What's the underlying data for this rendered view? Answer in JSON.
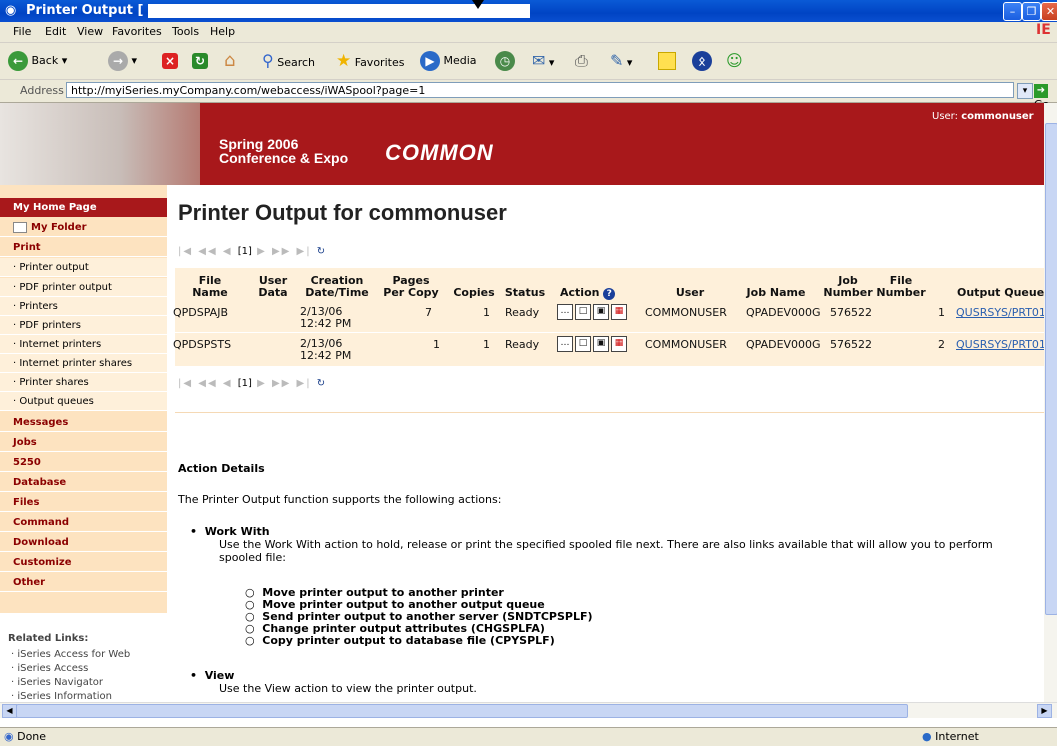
{
  "window": {
    "title": "Printer Output [",
    "ie_logo": "IE"
  },
  "menu": [
    "File",
    "Edit",
    "View",
    "Favorites",
    "Tools",
    "Help"
  ],
  "toolbar": {
    "back": "Back",
    "search": "Search",
    "favorites": "Favorites",
    "media": "Media"
  },
  "address": {
    "label": "Address",
    "url": "http://myiSeries.myCompany.com/webaccess/iWASpool?page=1",
    "go": "Go"
  },
  "banner": {
    "line1": "Spring 2006",
    "line2": "Conference & Expo",
    "logo": "COMMON",
    "user_label": "User:",
    "user": "commonuser"
  },
  "sidebar": {
    "home": "My Home Page",
    "folder": "My Folder",
    "print": "Print",
    "print_items": [
      "Printer output",
      "PDF printer output",
      "Printers",
      "PDF printers",
      "Internet printers",
      "Internet printer shares",
      "Printer shares",
      "Output queues"
    ],
    "sections": [
      "Messages",
      "Jobs",
      "5250",
      "Database",
      "Files",
      "Command",
      "Download",
      "Customize",
      "Other"
    ],
    "related_title": "Related Links:",
    "related": [
      "iSeries Access for Web",
      "iSeries Access",
      "iSeries Navigator",
      "iSeries Information"
    ]
  },
  "main": {
    "heading": "Printer Output for commonuser",
    "pager_page": "[1]",
    "columns": {
      "file_name": [
        "File",
        "Name"
      ],
      "user_data": [
        "User",
        "Data"
      ],
      "creation": [
        "Creation",
        "Date/Time"
      ],
      "pages": [
        "Pages",
        "Per Copy"
      ],
      "copies": "Copies",
      "status": "Status",
      "action": "Action",
      "user": "User",
      "job_name": "Job Name",
      "job_number": [
        "Job",
        "Number"
      ],
      "file_number": [
        "File",
        "Number"
      ],
      "output_queue": "Output Queue"
    },
    "rows": [
      {
        "file": "QPDSPAJB",
        "date": "2/13/06",
        "time": "12:42 PM",
        "pages": "7",
        "copies": "1",
        "status": "Ready",
        "user": "COMMONUSER",
        "job": "QPADEV000G",
        "jobnum": "576522",
        "filenum": "1",
        "queue": "QUSRSYS/PRT01"
      },
      {
        "file": "QPDSPSTS",
        "date": "2/13/06",
        "time": "12:42 PM",
        "pages": "1",
        "copies": "1",
        "status": "Ready",
        "user": "COMMONUSER",
        "job": "QPADEV000G",
        "jobnum": "576522",
        "filenum": "2",
        "queue": "QUSRSYS/PRT01"
      }
    ],
    "action_details": "Action Details",
    "intro": "The Printer Output function supports the following actions:",
    "work_with_title": "Work With",
    "work_with_desc1": "Use the Work With action to hold, release or print the specified spooled file next. There are also links available that will allow you to perform",
    "work_with_desc2": "spooled file:",
    "work_with_items": [
      "Move printer output to another printer",
      "Move printer output to another output queue",
      "Send printer output to another server (SNDTCPSPLF)",
      "Change printer output attributes (CHGSPLFA)",
      "Copy printer output to database file (CPYSPLF)"
    ],
    "view_title": "View",
    "view_desc": "Use the View action to view the printer output."
  },
  "status": {
    "left": "Done",
    "zone": "Internet"
  }
}
